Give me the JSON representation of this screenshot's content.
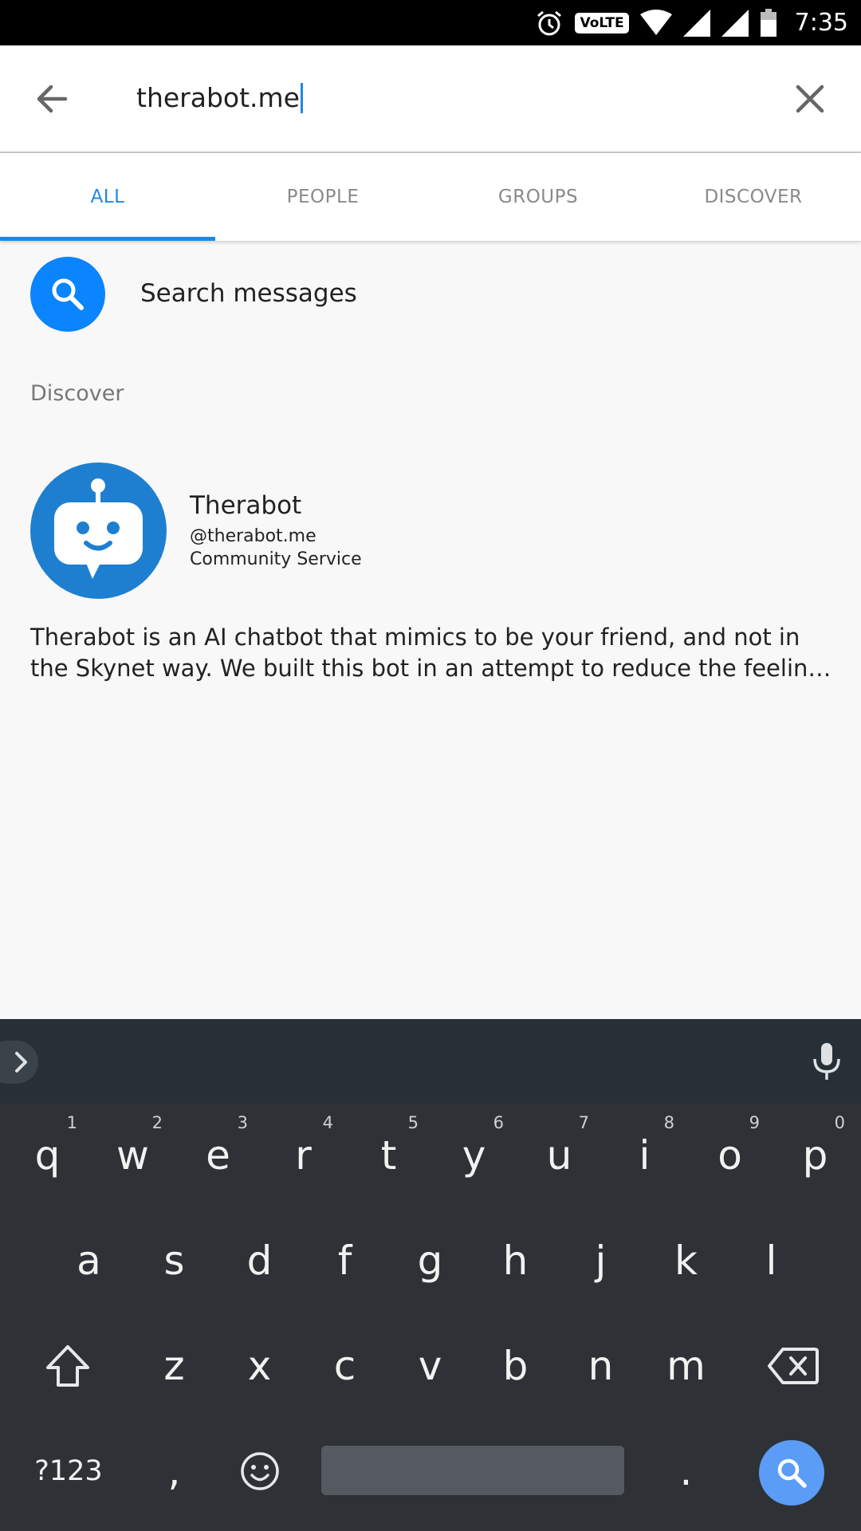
{
  "status_bar": {
    "time": "7:35",
    "volte": "VoLTE",
    "icons": [
      "alarm-icon",
      "volte-icon",
      "wifi-icon",
      "signal-icon",
      "signal-icon",
      "battery-icon"
    ]
  },
  "search": {
    "query": "therabot.me",
    "back_icon": "arrow-left-icon",
    "clear_icon": "close-icon"
  },
  "tabs": [
    {
      "label": "ALL",
      "active": true
    },
    {
      "label": "PEOPLE",
      "active": false
    },
    {
      "label": "GROUPS",
      "active": false
    },
    {
      "label": "DISCOVER",
      "active": false
    }
  ],
  "search_messages": {
    "label": "Search messages",
    "icon": "search-icon"
  },
  "discover": {
    "section_title": "Discover",
    "result": {
      "name": "Therabot",
      "handle": "@therabot.me",
      "category": "Community Service",
      "description": "Therabot is an AI chatbot that mimics to be your friend, and not in the Skynet way. We built this bot in an attempt to reduce the feelin…",
      "avatar_icon": "robot-icon"
    }
  },
  "keyboard": {
    "row1": [
      {
        "k": "q",
        "h": "1"
      },
      {
        "k": "w",
        "h": "2"
      },
      {
        "k": "e",
        "h": "3"
      },
      {
        "k": "r",
        "h": "4"
      },
      {
        "k": "t",
        "h": "5"
      },
      {
        "k": "y",
        "h": "6"
      },
      {
        "k": "u",
        "h": "7"
      },
      {
        "k": "i",
        "h": "8"
      },
      {
        "k": "o",
        "h": "9"
      },
      {
        "k": "p",
        "h": "0"
      }
    ],
    "row2": [
      "a",
      "s",
      "d",
      "f",
      "g",
      "h",
      "j",
      "k",
      "l"
    ],
    "row3": [
      "z",
      "x",
      "c",
      "v",
      "b",
      "n",
      "m"
    ],
    "symbols_label": "?123",
    "comma": ",",
    "period": "."
  },
  "colors": {
    "accent": "#1e88e5",
    "search_button": "#0a84ff",
    "avatar": "#1e7fd1",
    "keyboard_bg": "#2e3236"
  }
}
